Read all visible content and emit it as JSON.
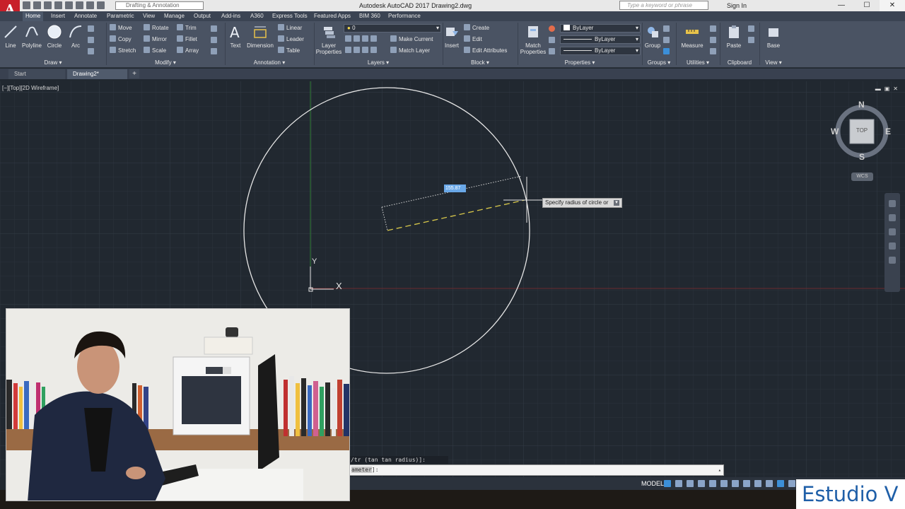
{
  "window": {
    "title": "Autodesk AutoCAD 2017    Drawing2.dwg",
    "app_logo": "A",
    "workspace": "Drafting & Annotation",
    "search_placeholder": "Type a keyword or phrase",
    "sign_in": "Sign In",
    "btn_min": "—",
    "btn_max": "☐",
    "btn_close": "✕"
  },
  "menu_tabs": [
    "Home",
    "Insert",
    "Annotate",
    "Parametric",
    "View",
    "Manage",
    "Output",
    "Add-ins",
    "A360",
    "Express Tools",
    "Featured Apps",
    "BIM 360",
    "Performance"
  ],
  "ribbon": {
    "draw": {
      "line": "Line",
      "polyline": "Polyline",
      "circle": "Circle",
      "arc": "Arc",
      "title": "Draw ▾"
    },
    "modify": {
      "move": "Move",
      "rotate": "Rotate",
      "trim": "Trim",
      "copy": "Copy",
      "mirror": "Mirror",
      "fillet": "Fillet",
      "stretch": "Stretch",
      "scale": "Scale",
      "array": "Array",
      "title": "Modify ▾"
    },
    "annotation": {
      "text": "Text",
      "dimension": "Dimension",
      "linear": "Linear",
      "leader": "Leader",
      "table": "Table",
      "title": "Annotation ▾"
    },
    "layers": {
      "layer_properties": "Layer Properties",
      "layer_value": "0",
      "make_current": "Make Current",
      "match_layer": "Match Layer",
      "title": "Layers ▾"
    },
    "block": {
      "insert": "Insert",
      "create": "Create",
      "edit": "Edit",
      "edit_attributes": "Edit Attributes",
      "title": "Block ▾"
    },
    "properties": {
      "match_properties": "Match Properties",
      "color": "ByLayer",
      "linetype": "ByLayer",
      "lineweight": "ByLayer",
      "title": "Properties ▾"
    },
    "groups": {
      "group": "Group",
      "title": "Groups ▾"
    },
    "utilities": {
      "measure": "Measure",
      "title": "Utilities ▾"
    },
    "clipboard": {
      "paste": "Paste",
      "title": "Clipboard"
    },
    "view": {
      "base": "Base",
      "title": "View ▾"
    }
  },
  "file_tabs": {
    "start": "Start",
    "drawing": "Drawing2*",
    "plus": "+"
  },
  "viewport": {
    "label": "[−][Top][2D Wireframe]",
    "ctrl_min": "▬",
    "ctrl_max": "▣",
    "ctrl_close": "✕",
    "dim_value": "155.87",
    "tooltip": "Specify radius of circle or",
    "tooltip_icon": "▾",
    "ucs_x": "X",
    "ucs_y": "Y",
    "compass": {
      "n": "N",
      "s": "S",
      "e": "E",
      "w": "W",
      "top": "TOP"
    },
    "wcs": "WCS"
  },
  "command": {
    "history": "/tr (tan tan radius)]:",
    "current_highlight": "ameter",
    "current_rest": "]:",
    "arrow": "▴"
  },
  "status": {
    "model": "MODEL"
  },
  "brand": "Estudio V",
  "colors": {
    "canvas": "#212830",
    "ribbon": "#4a5363",
    "tab_bar": "#3b4453",
    "accent_red": "#c8202a",
    "brand_blue": "#1f5fa8",
    "ucs_green": "#3aa83a",
    "axis_red": "#8a2a2a"
  }
}
